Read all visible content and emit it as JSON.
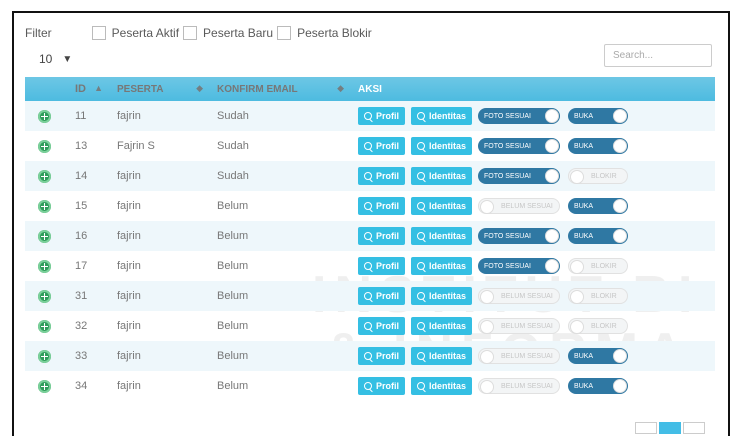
{
  "filters": {
    "label": "Filter",
    "checkboxes": [
      {
        "label": "Peserta Aktif"
      },
      {
        "label": "Peserta Baru"
      },
      {
        "label": "Peserta Blokir"
      }
    ]
  },
  "page_size": {
    "value": "10"
  },
  "search": {
    "placeholder": "Search..."
  },
  "table": {
    "headers": [
      "",
      "ID",
      "PESERTA",
      "KONFIRM EMAIL",
      "AKSI"
    ],
    "rows": [
      {
        "id": "11",
        "peserta": "fajrin",
        "email": "Sudah",
        "btn_profil": "Profil",
        "btn_identitas": "Identitas",
        "foto": "FOTO SESUAI",
        "foto_on": true,
        "status": "BUKA",
        "status_on": true
      },
      {
        "id": "13",
        "peserta": "Fajrin S",
        "email": "Sudah",
        "btn_profil": "Profil",
        "btn_identitas": "Identitas",
        "foto": "FOTO SESUAI",
        "foto_on": true,
        "status": "BUKA",
        "status_on": true
      },
      {
        "id": "14",
        "peserta": "fajrin",
        "email": "Sudah",
        "btn_profil": "Profil",
        "btn_identitas": "Identitas",
        "foto": "FOTO SESUAI",
        "foto_on": true,
        "status": "BLOKIR",
        "status_on": false
      },
      {
        "id": "15",
        "peserta": "fajrin",
        "email": "Belum",
        "btn_profil": "Profil",
        "btn_identitas": "Identitas",
        "foto": "BELUM SESUAI",
        "foto_on": false,
        "status": "BUKA",
        "status_on": true
      },
      {
        "id": "16",
        "peserta": "fajrin",
        "email": "Belum",
        "btn_profil": "Profil",
        "btn_identitas": "Identitas",
        "foto": "FOTO SESUAI",
        "foto_on": true,
        "status": "BUKA",
        "status_on": true
      },
      {
        "id": "17",
        "peserta": "fajrin",
        "email": "Belum",
        "btn_profil": "Profil",
        "btn_identitas": "Identitas",
        "foto": "FOTO SESUAI",
        "foto_on": true,
        "status": "BLOKIR",
        "status_on": false
      },
      {
        "id": "31",
        "peserta": "fajrin",
        "email": "Belum",
        "btn_profil": "Profil",
        "btn_identitas": "Identitas",
        "foto": "BELUM SESUAI",
        "foto_on": false,
        "status": "BLOKIR",
        "status_on": false
      },
      {
        "id": "32",
        "peserta": "fajrin",
        "email": "Belum",
        "btn_profil": "Profil",
        "btn_identitas": "Identitas",
        "foto": "BELUM SESUAI",
        "foto_on": false,
        "status": "BLOKIR",
        "status_on": false
      },
      {
        "id": "33",
        "peserta": "fajrin",
        "email": "Belum",
        "btn_profil": "Profil",
        "btn_identitas": "Identitas",
        "foto": "BELUM SESUAI",
        "foto_on": false,
        "status": "BUKA",
        "status_on": true
      },
      {
        "id": "34",
        "peserta": "fajrin",
        "email": "Belum",
        "btn_profil": "Profil",
        "btn_identitas": "Identitas",
        "foto": "BELUM SESUAI",
        "foto_on": false,
        "status": "BUKA",
        "status_on": true
      }
    ]
  },
  "colors": {
    "header_bg": "#4dbbe0",
    "button_bg": "#35bfe3",
    "toggle_on": "#2f78a3",
    "row_alt": "#eef7fb",
    "expand_icon": "#2e9d5a"
  },
  "watermark": {
    "line1": "INSTITUT BI",
    "line2": "& INFORMA"
  }
}
